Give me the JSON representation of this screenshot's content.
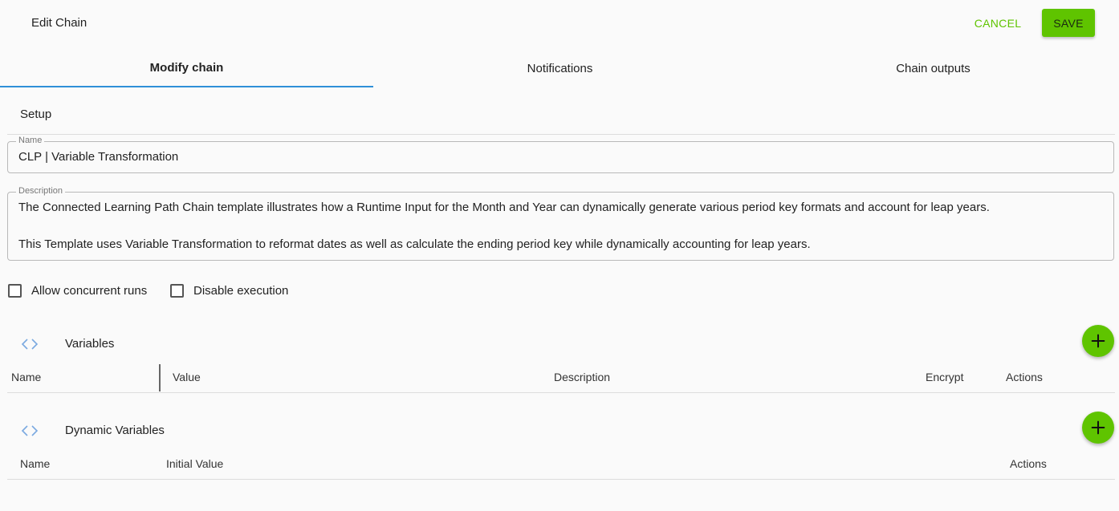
{
  "header": {
    "title": "Edit Chain",
    "cancel_label": "CANCEL",
    "save_label": "SAVE"
  },
  "tabs": [
    {
      "label": "Modify chain",
      "active": true
    },
    {
      "label": "Notifications",
      "active": false
    },
    {
      "label": "Chain outputs",
      "active": false
    }
  ],
  "setup": {
    "section_label": "Setup",
    "name_field": {
      "legend": "Name",
      "value": "CLP | Variable Transformation"
    },
    "description_field": {
      "legend": "Description",
      "lines": [
        "The Connected Learning Path Chain template illustrates how a Runtime Input for the Month and Year can dynamically generate various period key formats and account for leap years.",
        "",
        "This Template uses Variable Transformation to reformat dates as well as calculate the ending period key while dynamically accounting for leap years."
      ]
    },
    "checkboxes": [
      {
        "label": "Allow concurrent runs",
        "checked": false
      },
      {
        "label": "Disable execution",
        "checked": false
      }
    ]
  },
  "variables": {
    "title": "Variables",
    "icon": "code-icon",
    "columns": [
      "Name",
      "Value",
      "Description",
      "Encrypt",
      "Actions"
    ]
  },
  "dynamic_variables": {
    "title": "Dynamic Variables",
    "icon": "code-icon",
    "columns": [
      "Name",
      "Initial Value",
      "Actions"
    ]
  },
  "colors": {
    "accent_green": "#5fc400",
    "tab_underline": "#2f8fd8",
    "icon_blue": "#7aa9e0"
  }
}
